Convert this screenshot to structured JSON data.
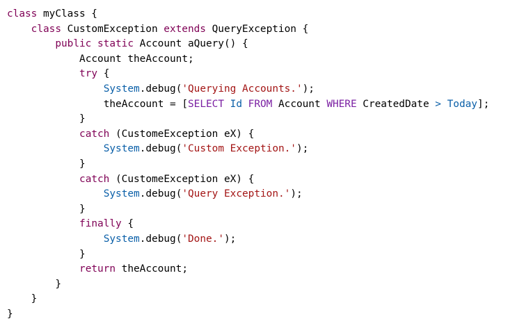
{
  "editor": {
    "colors": {
      "background": "#ffffff",
      "plain": "#000000",
      "keyword": "#7f0055",
      "string": "#a31515",
      "api": "#0a5fa8",
      "sql": "#7a1fa2"
    },
    "lines": [
      {
        "indent": 0,
        "tokens": [
          {
            "type": "kw",
            "text": "class"
          },
          {
            "type": "plain",
            "text": " myClass {"
          }
        ]
      },
      {
        "indent": 4,
        "tokens": [
          {
            "type": "kw",
            "text": "class"
          },
          {
            "type": "plain",
            "text": " CustomException "
          },
          {
            "type": "kw",
            "text": "extends"
          },
          {
            "type": "plain",
            "text": " QueryException {"
          }
        ]
      },
      {
        "indent": 8,
        "tokens": [
          {
            "type": "kw",
            "text": "public"
          },
          {
            "type": "plain",
            "text": " "
          },
          {
            "type": "kw",
            "text": "static"
          },
          {
            "type": "plain",
            "text": " Account aQuery() {"
          }
        ]
      },
      {
        "indent": 12,
        "tokens": [
          {
            "type": "plain",
            "text": "Account theAccount;"
          }
        ]
      },
      {
        "indent": 12,
        "tokens": [
          {
            "type": "kw",
            "text": "try"
          },
          {
            "type": "plain",
            "text": " {"
          }
        ]
      },
      {
        "indent": 16,
        "tokens": [
          {
            "type": "api",
            "text": "System"
          },
          {
            "type": "plain",
            "text": "."
          },
          {
            "type": "plain",
            "text": "debug("
          },
          {
            "type": "str",
            "text": "'Querying Accounts.'"
          },
          {
            "type": "plain",
            "text": ");"
          }
        ]
      },
      {
        "indent": 16,
        "tokens": [
          {
            "type": "plain",
            "text": "theAccount = ["
          },
          {
            "type": "sql",
            "text": "SELECT"
          },
          {
            "type": "plain",
            "text": " "
          },
          {
            "type": "api",
            "text": "Id"
          },
          {
            "type": "plain",
            "text": " "
          },
          {
            "type": "sql",
            "text": "FROM"
          },
          {
            "type": "plain",
            "text": " Account "
          },
          {
            "type": "sql",
            "text": "WHERE"
          },
          {
            "type": "plain",
            "text": " CreatedDate "
          },
          {
            "type": "op",
            "text": ">"
          },
          {
            "type": "plain",
            "text": " "
          },
          {
            "type": "api",
            "text": "Today"
          },
          {
            "type": "plain",
            "text": "];"
          }
        ]
      },
      {
        "indent": 12,
        "tokens": [
          {
            "type": "plain",
            "text": "}"
          }
        ]
      },
      {
        "indent": 12,
        "tokens": [
          {
            "type": "kw",
            "text": "catch"
          },
          {
            "type": "plain",
            "text": " (CustomeException eX) {"
          }
        ]
      },
      {
        "indent": 16,
        "tokens": [
          {
            "type": "api",
            "text": "System"
          },
          {
            "type": "plain",
            "text": "."
          },
          {
            "type": "plain",
            "text": "debug("
          },
          {
            "type": "str",
            "text": "'Custom Exception.'"
          },
          {
            "type": "plain",
            "text": ");"
          }
        ]
      },
      {
        "indent": 12,
        "tokens": [
          {
            "type": "plain",
            "text": "}"
          }
        ]
      },
      {
        "indent": 12,
        "tokens": [
          {
            "type": "kw",
            "text": "catch"
          },
          {
            "type": "plain",
            "text": " (CustomeException eX) {"
          }
        ]
      },
      {
        "indent": 16,
        "tokens": [
          {
            "type": "api",
            "text": "System"
          },
          {
            "type": "plain",
            "text": "."
          },
          {
            "type": "plain",
            "text": "debug("
          },
          {
            "type": "str",
            "text": "'Query Exception.'"
          },
          {
            "type": "plain",
            "text": ");"
          }
        ]
      },
      {
        "indent": 12,
        "tokens": [
          {
            "type": "plain",
            "text": "}"
          }
        ]
      },
      {
        "indent": 12,
        "tokens": [
          {
            "type": "kw",
            "text": "finally"
          },
          {
            "type": "plain",
            "text": " {"
          }
        ]
      },
      {
        "indent": 16,
        "tokens": [
          {
            "type": "api",
            "text": "System"
          },
          {
            "type": "plain",
            "text": "."
          },
          {
            "type": "plain",
            "text": "debug("
          },
          {
            "type": "str",
            "text": "'Done.'"
          },
          {
            "type": "plain",
            "text": ");"
          }
        ]
      },
      {
        "indent": 12,
        "tokens": [
          {
            "type": "plain",
            "text": "}"
          }
        ]
      },
      {
        "indent": 12,
        "tokens": [
          {
            "type": "kw",
            "text": "return"
          },
          {
            "type": "plain",
            "text": " theAccount;"
          }
        ]
      },
      {
        "indent": 8,
        "tokens": [
          {
            "type": "plain",
            "text": "}"
          }
        ]
      },
      {
        "indent": 4,
        "tokens": [
          {
            "type": "plain",
            "text": "}"
          }
        ]
      },
      {
        "indent": 0,
        "tokens": [
          {
            "type": "plain",
            "text": "}"
          }
        ]
      }
    ]
  }
}
